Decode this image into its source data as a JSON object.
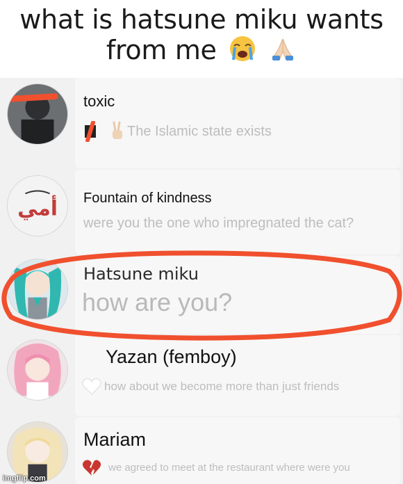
{
  "caption": {
    "line1": "what is hatsune miku wants",
    "line2": "from me",
    "emojis": [
      "loudly-crying-face-icon",
      "folded-hands-icon"
    ]
  },
  "chats": [
    {
      "name": "toxic",
      "message": "The Islamic state exists",
      "prefix_icon": "hand-peace-icon",
      "avatar_icon": "redacted-avatar-icon"
    },
    {
      "name": "Fountain of kindness",
      "message": "were you the one who impregnated the cat?",
      "avatar_text": "أمي",
      "avatar_icon": "arabic-calligraphy-avatar-icon"
    },
    {
      "name": "Hatsune miku",
      "message": "how are you?",
      "avatar_icon": "anime-avatar-icon",
      "highlighted": true
    },
    {
      "name": "Yazan (femboy)",
      "message": "how about we become more than just friends",
      "prefix_icon": "white-heart-icon",
      "avatar_icon": "anime-avatar-icon"
    },
    {
      "name": "Mariam",
      "message": "we agreed to meet at the restaurant where were you",
      "prefix_icon": "broken-heart-icon",
      "avatar_icon": "anime-avatar-icon"
    }
  ],
  "annotation_color": "#f0502e",
  "watermark": "imgflip.com"
}
